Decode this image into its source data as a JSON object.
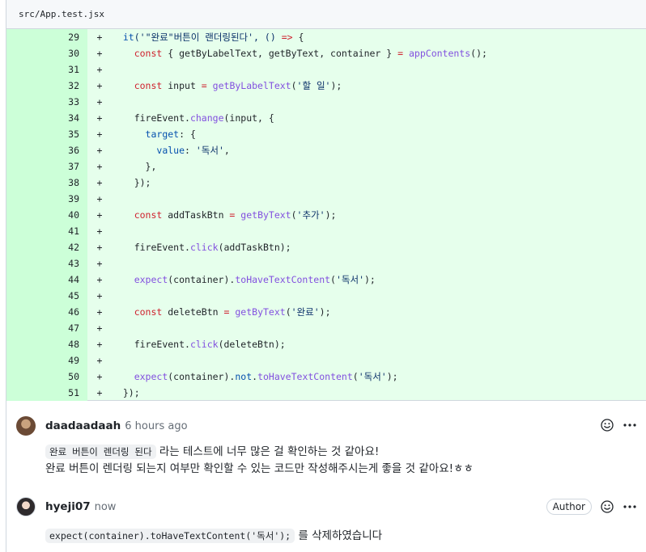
{
  "file": {
    "path": "src/App.test.jsx"
  },
  "diff_lines": [
    {
      "num": "29",
      "marker": "+",
      "indent": "  ",
      "tokens": [
        [
          "it",
          "c"
        ],
        [
          "('\"완료\"버튼이 랜더링된다', () ",
          "s"
        ],
        [
          "=>",
          "k"
        ],
        [
          " {",
          ""
        ]
      ]
    },
    {
      "num": "30",
      "marker": "+",
      "indent": "    ",
      "tokens": [
        [
          "const",
          "k"
        ],
        [
          " { getByLabelText, getByText, container } ",
          ""
        ],
        [
          "=",
          "k"
        ],
        [
          " ",
          ""
        ],
        [
          "appContents",
          "f"
        ],
        [
          "();",
          ""
        ]
      ]
    },
    {
      "num": "31",
      "marker": "+",
      "indent": "",
      "tokens": []
    },
    {
      "num": "32",
      "marker": "+",
      "indent": "    ",
      "tokens": [
        [
          "const",
          "k"
        ],
        [
          " input ",
          ""
        ],
        [
          "=",
          "k"
        ],
        [
          " ",
          ""
        ],
        [
          "getByLabelText",
          "f"
        ],
        [
          "(",
          ""
        ],
        [
          "'할 일'",
          "s"
        ],
        [
          ");",
          ""
        ]
      ]
    },
    {
      "num": "33",
      "marker": "+",
      "indent": "",
      "tokens": []
    },
    {
      "num": "34",
      "marker": "+",
      "indent": "    ",
      "tokens": [
        [
          "fireEvent.",
          ""
        ],
        [
          "change",
          "f"
        ],
        [
          "(input, {",
          ""
        ]
      ]
    },
    {
      "num": "35",
      "marker": "+",
      "indent": "      ",
      "tokens": [
        [
          "target",
          "c"
        ],
        [
          ": {",
          ""
        ]
      ]
    },
    {
      "num": "36",
      "marker": "+",
      "indent": "        ",
      "tokens": [
        [
          "value",
          "c"
        ],
        [
          ": ",
          ""
        ],
        [
          "'독서'",
          "s"
        ],
        [
          ",",
          ""
        ]
      ]
    },
    {
      "num": "37",
      "marker": "+",
      "indent": "      ",
      "tokens": [
        [
          "},",
          ""
        ]
      ]
    },
    {
      "num": "38",
      "marker": "+",
      "indent": "    ",
      "tokens": [
        [
          "});",
          ""
        ]
      ]
    },
    {
      "num": "39",
      "marker": "+",
      "indent": "",
      "tokens": []
    },
    {
      "num": "40",
      "marker": "+",
      "indent": "    ",
      "tokens": [
        [
          "const",
          "k"
        ],
        [
          " addTaskBtn ",
          ""
        ],
        [
          "=",
          "k"
        ],
        [
          " ",
          ""
        ],
        [
          "getByText",
          "f"
        ],
        [
          "(",
          ""
        ],
        [
          "'추가'",
          "s"
        ],
        [
          ");",
          ""
        ]
      ]
    },
    {
      "num": "41",
      "marker": "+",
      "indent": "",
      "tokens": []
    },
    {
      "num": "42",
      "marker": "+",
      "indent": "    ",
      "tokens": [
        [
          "fireEvent.",
          ""
        ],
        [
          "click",
          "f"
        ],
        [
          "(addTaskBtn);",
          ""
        ]
      ]
    },
    {
      "num": "43",
      "marker": "+",
      "indent": "",
      "tokens": []
    },
    {
      "num": "44",
      "marker": "+",
      "indent": "    ",
      "tokens": [
        [
          "expect",
          "f"
        ],
        [
          "(container).",
          ""
        ],
        [
          "toHaveTextContent",
          "f"
        ],
        [
          "(",
          ""
        ],
        [
          "'독서'",
          "s"
        ],
        [
          ");",
          ""
        ]
      ]
    },
    {
      "num": "45",
      "marker": "+",
      "indent": "",
      "tokens": []
    },
    {
      "num": "46",
      "marker": "+",
      "indent": "    ",
      "tokens": [
        [
          "const",
          "k"
        ],
        [
          " deleteBtn ",
          ""
        ],
        [
          "=",
          "k"
        ],
        [
          " ",
          ""
        ],
        [
          "getByText",
          "f"
        ],
        [
          "(",
          ""
        ],
        [
          "'완료'",
          "s"
        ],
        [
          ");",
          ""
        ]
      ]
    },
    {
      "num": "47",
      "marker": "+",
      "indent": "",
      "tokens": []
    },
    {
      "num": "48",
      "marker": "+",
      "indent": "    ",
      "tokens": [
        [
          "fireEvent.",
          ""
        ],
        [
          "click",
          "f"
        ],
        [
          "(deleteBtn);",
          ""
        ]
      ]
    },
    {
      "num": "49",
      "marker": "+",
      "indent": "",
      "tokens": []
    },
    {
      "num": "50",
      "marker": "+",
      "indent": "    ",
      "tokens": [
        [
          "expect",
          "f"
        ],
        [
          "(container).",
          ""
        ],
        [
          "not",
          "c"
        ],
        [
          ".",
          ""
        ],
        [
          "toHaveTextContent",
          "f"
        ],
        [
          "(",
          ""
        ],
        [
          "'독서'",
          "s"
        ],
        [
          ");",
          ""
        ]
      ]
    },
    {
      "num": "51",
      "marker": "+",
      "indent": "  ",
      "tokens": [
        [
          "});",
          ""
        ]
      ]
    }
  ],
  "comments": [
    {
      "author": "daadaadaah",
      "time": "6 hours ago",
      "code": "완료 버튼이 렌더링 된다",
      "line1_rest": " 라는 테스트에 너무 많은 걸 확인하는 것 같아요!",
      "line2": "완료 버튼이 렌더링 되는지 여부만 확인할 수 있는 코드만 작성해주시는게 좋을 것 같아요!ㅎㅎ"
    },
    {
      "author": "hyeji07",
      "time": "now",
      "badge": "Author",
      "code": "expect(container).toHaveTextContent('독서');",
      "line1_rest": " 를 삭제하였습니다"
    }
  ],
  "icons": {
    "reaction": "smiley-icon",
    "menu": "kebab-horizontal-icon"
  },
  "colors": {
    "added_bg": "#e6ffec",
    "added_gutter": "#ccffd8",
    "border": "#d0d7de"
  }
}
